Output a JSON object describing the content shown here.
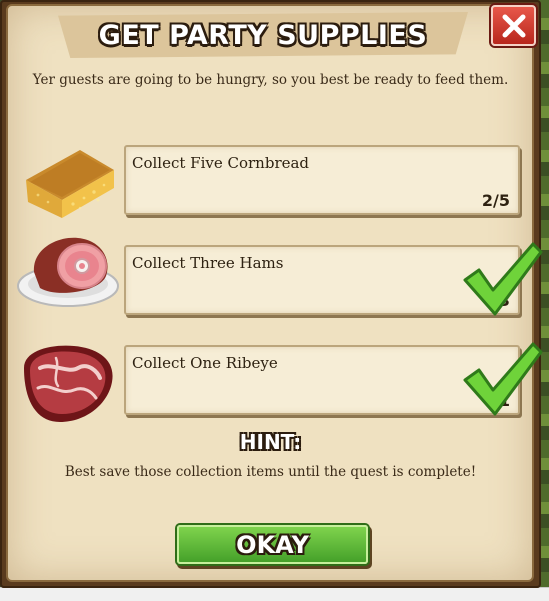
{
  "dialog": {
    "title": "GET PARTY SUPPLIES",
    "subtitle": "Yer guests are going to be hungry, so you best be ready to feed them.",
    "close_icon": "close-icon"
  },
  "tasks": [
    {
      "label": "Collect Five Cornbread",
      "count": "2/5",
      "icon": "cornbread-icon",
      "complete": false
    },
    {
      "label": "Collect Three Hams",
      "count": "3",
      "icon": "ham-icon",
      "complete": true
    },
    {
      "label": "Collect One Ribeye",
      "count": "1",
      "icon": "ribeye-icon",
      "complete": true
    }
  ],
  "hint": {
    "title": "HINT:",
    "text": "Best save those collection items until the quest is complete!"
  },
  "okay_button": {
    "label": "OKAY"
  },
  "colors": {
    "panel": "#efe1c1",
    "frame": "#5a3b1e",
    "close_button": "#c8342a",
    "okay_button": "#5cb838",
    "checkmark": "#6fd33a"
  }
}
